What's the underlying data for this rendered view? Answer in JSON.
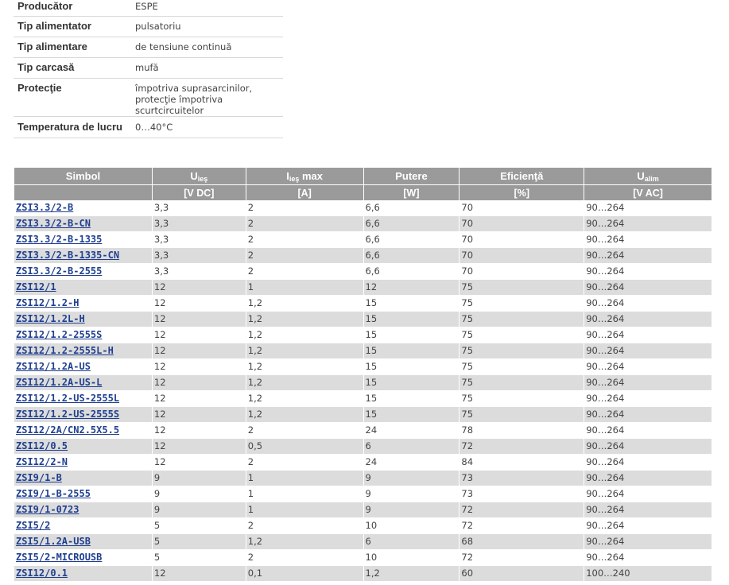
{
  "specs": [
    {
      "label": "Producător",
      "value": "ESPE"
    },
    {
      "label": "Tip alimentator",
      "value": "pulsatoriu"
    },
    {
      "label": "Tip alimentare",
      "value": "de tensiune continuă"
    },
    {
      "label": "Tip carcasă",
      "value": "mufă"
    },
    {
      "label": "Protecţie",
      "value_line1": "împotriva suprasarcinilor,",
      "value_line2": "protecţie împotriva scurtcircuitelor"
    },
    {
      "label": "Temperatura de lucru",
      "value": "0…40°C"
    }
  ],
  "table": {
    "headers": {
      "simbol": "Simbol",
      "u_out_main": "U",
      "u_out_sub": "ieş",
      "i_out_main": "I",
      "i_out_sub": "ieş",
      "i_out_suffix": " max",
      "putere": "Putere",
      "eficienta": "Eficienţă",
      "u_alim_main": "U",
      "u_alim_sub": "alim"
    },
    "units": [
      "[V DC]",
      "[A]",
      "[W]",
      "[%]",
      "[V AC]"
    ],
    "rows": [
      [
        "ZSI3.3/2-B",
        "3,3",
        "2",
        "6,6",
        "70",
        "90…264"
      ],
      [
        "ZSI3.3/2-B-CN",
        "3,3",
        "2",
        "6,6",
        "70",
        "90…264"
      ],
      [
        "ZSI3.3/2-B-1335",
        "3,3",
        "2",
        "6,6",
        "70",
        "90…264"
      ],
      [
        "ZSI3.3/2-B-1335-CN",
        "3,3",
        "2",
        "6,6",
        "70",
        "90…264"
      ],
      [
        "ZSI3.3/2-B-2555",
        "3,3",
        "2",
        "6,6",
        "70",
        "90…264"
      ],
      [
        "ZSI12/1",
        "12",
        "1",
        "12",
        "75",
        "90…264"
      ],
      [
        "ZSI12/1.2-H",
        "12",
        "1,2",
        "15",
        "75",
        "90…264"
      ],
      [
        "ZSI12/1.2L-H",
        "12",
        "1,2",
        "15",
        "75",
        "90…264"
      ],
      [
        "ZSI12/1.2-2555S",
        "12",
        "1,2",
        "15",
        "75",
        "90…264"
      ],
      [
        "ZSI12/1.2-2555L-H",
        "12",
        "1,2",
        "15",
        "75",
        "90…264"
      ],
      [
        "ZSI12/1.2A-US",
        "12",
        "1,2",
        "15",
        "75",
        "90…264"
      ],
      [
        "ZSI12/1.2A-US-L",
        "12",
        "1,2",
        "15",
        "75",
        "90…264"
      ],
      [
        "ZSI12/1.2-US-2555L",
        "12",
        "1,2",
        "15",
        "75",
        "90…264"
      ],
      [
        "ZSI12/1.2-US-2555S",
        "12",
        "1,2",
        "15",
        "75",
        "90…264"
      ],
      [
        "ZSI12/2A/CN2.5X5.5",
        "12",
        "2",
        "24",
        "78",
        "90…264"
      ],
      [
        "ZSI12/0.5",
        "12",
        "0,5",
        "6",
        "72",
        "90…264"
      ],
      [
        "ZSI12/2-N",
        "12",
        "2",
        "24",
        "84",
        "90…264"
      ],
      [
        "ZSI9/1-B",
        "9",
        "1",
        "9",
        "73",
        "90…264"
      ],
      [
        "ZSI9/1-B-2555",
        "9",
        "1",
        "9",
        "73",
        "90…264"
      ],
      [
        "ZSI9/1-0723",
        "9",
        "1",
        "9",
        "72",
        "90…264"
      ],
      [
        "ZSI5/2",
        "5",
        "2",
        "10",
        "72",
        "90…264"
      ],
      [
        "ZSI5/1.2A-USB",
        "5",
        "1,2",
        "6",
        "68",
        "90…264"
      ],
      [
        "ZSI5/2-MICROUSB",
        "5",
        "2",
        "10",
        "72",
        "90…264"
      ],
      [
        "ZSI12/0.1",
        "12",
        "0,1",
        "1,2",
        "60",
        "100…240"
      ]
    ]
  }
}
